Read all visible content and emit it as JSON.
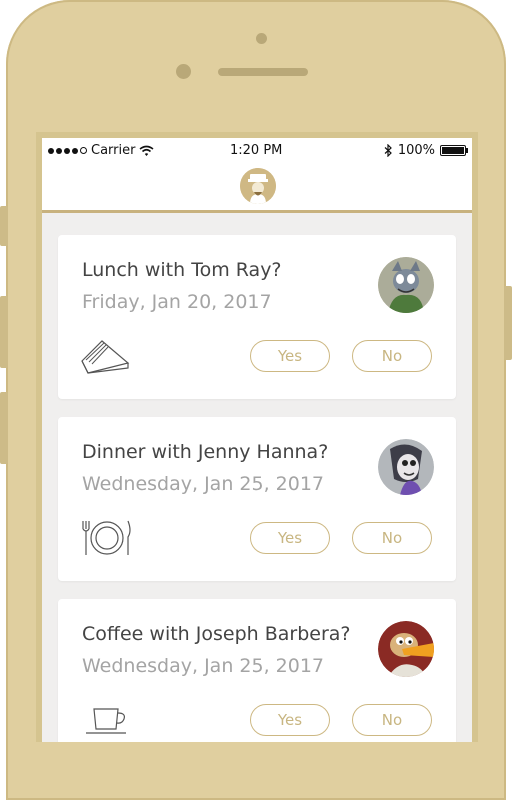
{
  "status_bar": {
    "carrier": "Carrier",
    "time": "1:20 PM",
    "battery": "100%"
  },
  "invitations": [
    {
      "title": "Lunch with Tom Ray?",
      "date": "Friday, Jan 20, 2017",
      "icon": "sandwich-icon",
      "yes_label": "Yes",
      "no_label": "No"
    },
    {
      "title": "Dinner with Jenny Hanna?",
      "date": "Wednesday, Jan 25, 2017",
      "icon": "plate-cutlery-icon",
      "yes_label": "Yes",
      "no_label": "No"
    },
    {
      "title": "Coffee with Joseph Barbera?",
      "date": "Wednesday, Jan 25, 2017",
      "icon": "coffee-cup-icon",
      "yes_label": "Yes",
      "no_label": "No"
    }
  ],
  "colors": {
    "accent": "#cdb883",
    "phone_body": "#e0cf9f",
    "card_bg": "#ffffff",
    "screen_bg": "#f0efee"
  }
}
